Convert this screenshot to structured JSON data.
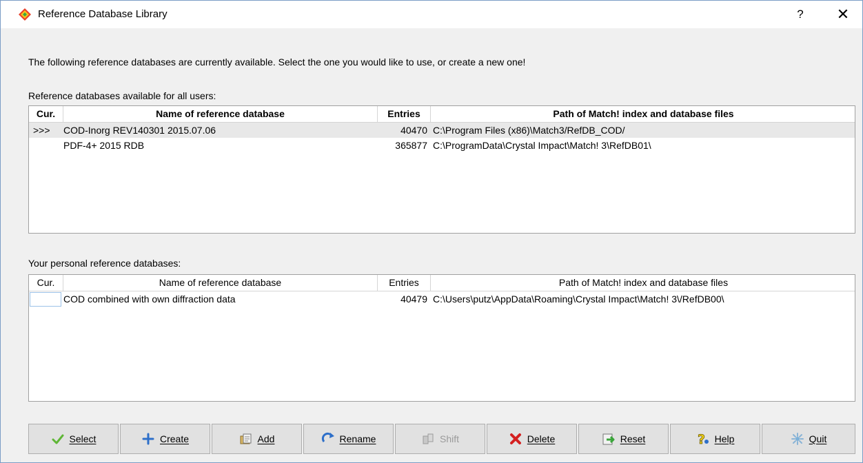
{
  "window": {
    "title": "Reference Database Library",
    "help_glyph": "?",
    "close_glyph": "✕"
  },
  "intro_text": "The following reference databases are currently available. Select the one you would like to use, or create a new one!",
  "all_users": {
    "label": "Reference databases available for all users:",
    "columns": [
      "Cur.",
      "Name of reference database",
      "Entries",
      "Path of Match! index and database files"
    ],
    "rows": [
      {
        "cur": ">>>",
        "name": "COD-Inorg REV140301 2015.07.06",
        "entries": "40470",
        "path": "C:\\Program Files (x86)\\Match3/RefDB_COD/"
      },
      {
        "cur": "",
        "name": "PDF-4+ 2015 RDB",
        "entries": "365877",
        "path": "C:\\ProgramData\\Crystal Impact\\Match! 3\\RefDB01\\"
      }
    ]
  },
  "personal": {
    "label": "Your personal reference databases:",
    "columns": [
      "Cur.",
      "Name of reference database",
      "Entries",
      "Path of Match! index and database files"
    ],
    "rows": [
      {
        "cur": "",
        "name": "COD combined with own diffraction data",
        "entries": "40479",
        "path": "C:\\Users\\putz\\AppData\\Roaming\\Crystal Impact\\Match! 3\\/RefDB00\\"
      }
    ]
  },
  "buttons": [
    {
      "label": "Select",
      "icon": "checkmark-icon",
      "enabled": true
    },
    {
      "label": "Create",
      "icon": "plus-icon",
      "enabled": true
    },
    {
      "label": "Add",
      "icon": "add-folder-icon",
      "enabled": true
    },
    {
      "label": "Rename",
      "icon": "rename-arrow-icon",
      "enabled": true
    },
    {
      "label": "Shift",
      "icon": "shift-icon",
      "enabled": false
    },
    {
      "label": "Delete",
      "icon": "delete-x-icon",
      "enabled": true
    },
    {
      "label": "Reset",
      "icon": "reset-icon",
      "enabled": true
    },
    {
      "label": "Help",
      "icon": "help-question-icon",
      "enabled": true
    },
    {
      "label": "Quit",
      "icon": "quit-icon",
      "enabled": true
    }
  ],
  "colors": {
    "selected_row": "#e8e8e8",
    "delete_red": "#d42020",
    "select_green": "#5fb636",
    "create_blue": "#2d6fc9"
  }
}
